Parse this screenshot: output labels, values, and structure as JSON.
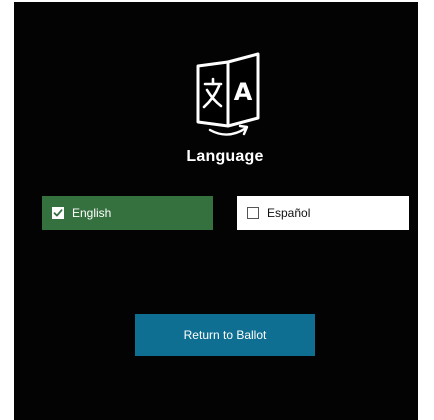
{
  "header": {
    "icon": "translate-icon",
    "title": "Language"
  },
  "languages": [
    {
      "label": "English",
      "selected": true
    },
    {
      "label": "Español",
      "selected": false
    }
  ],
  "actions": {
    "return_label": "Return to Ballot"
  },
  "colors": {
    "background": "#030303",
    "selected_option": "#35703f",
    "unselected_option": "#ffffff",
    "primary_button": "#0f6f93",
    "text_light": "#ffffff",
    "text_dark": "#111111"
  }
}
